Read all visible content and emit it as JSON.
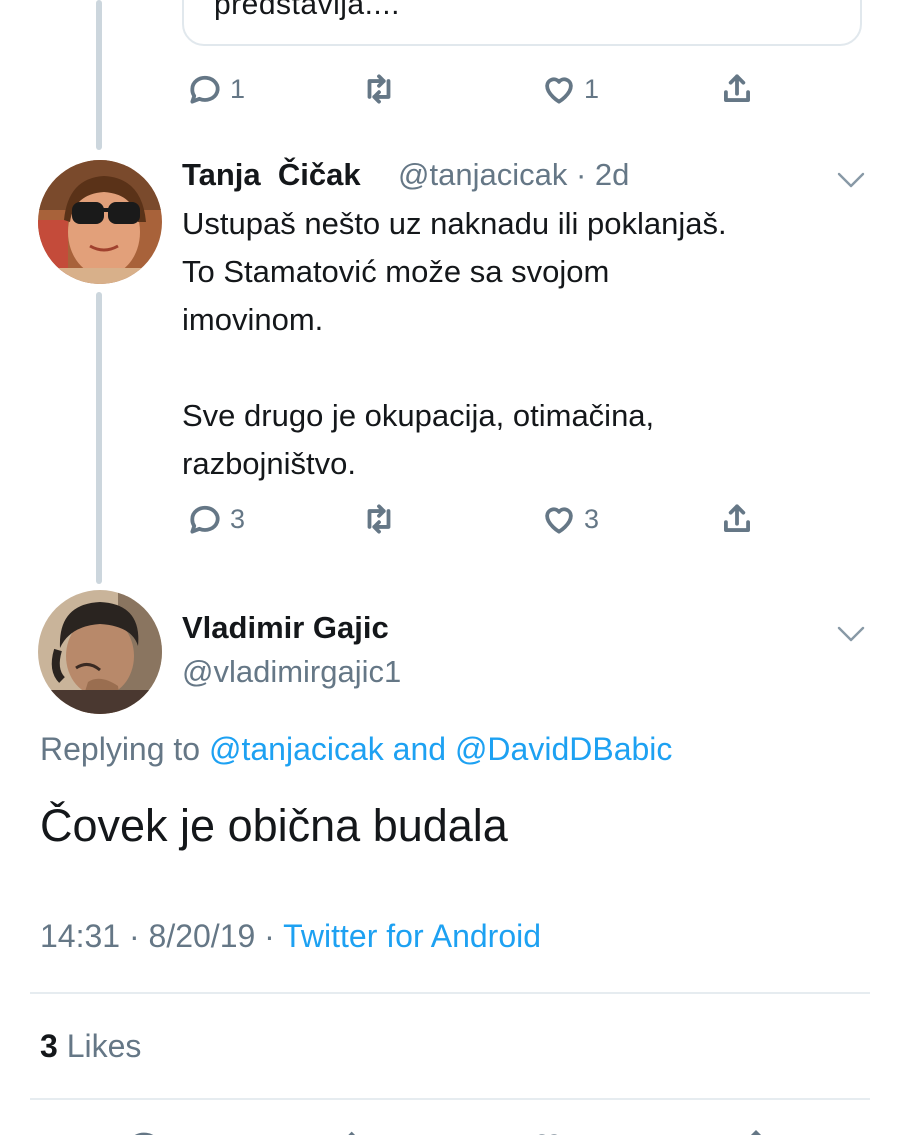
{
  "quoted_tweet": {
    "text_fragment": "predstavija...."
  },
  "tweet1_actions": {
    "replies": "1",
    "retweets": "",
    "likes": "1"
  },
  "tweet2": {
    "author_name": "Tanja  Čičak",
    "handle": "@tanjacicak",
    "time": "· 2d",
    "text_lines": [
      "Ustupaš nešto uz naknadu ili poklanjaš.",
      "To Stamatović može sa svojom",
      "imovinom.",
      "",
      "Sve drugo je okupacija, otimačina,",
      "razbojništvo."
    ],
    "actions": {
      "replies": "3",
      "retweets": "",
      "likes": "3"
    }
  },
  "main_tweet": {
    "author_name": "Vladimir Gajic",
    "handle": "@vladimirgajic1",
    "replying_prefix": "Replying to",
    "replying_mention_1": "@tanjacicak",
    "replying_and": "and",
    "replying_mention_2": "@DavidDBabic",
    "text": "Čovek je obična budala",
    "time": "14:31",
    "separator": "·",
    "date": "8/20/19",
    "source": "Twitter for Android",
    "likes_count": "3",
    "likes_label": "Likes"
  },
  "icons": {
    "reply": "reply-icon",
    "retweet": "retweet-icon",
    "like": "heart-icon",
    "share": "share-icon",
    "more": "chevron-down-icon"
  },
  "colors": {
    "link": "#1da1f2",
    "secondary_text": "#657786",
    "thread_line": "#ccd6dd"
  }
}
